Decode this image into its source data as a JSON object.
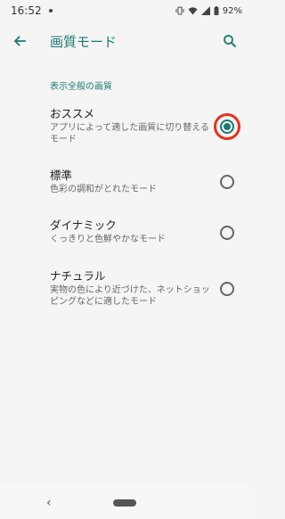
{
  "status": {
    "time": "16:52",
    "battery": "92%"
  },
  "app_bar": {
    "title": "画質モード",
    "back_icon": "arrow-back-icon",
    "search_icon": "search-icon"
  },
  "section": {
    "header": "表示全般の画質"
  },
  "options": [
    {
      "title": "おススメ",
      "desc": "アプリによって適した画質に切り替えるモード",
      "selected": true
    },
    {
      "title": "標準",
      "desc": "色彩の調和がとれたモード",
      "selected": false
    },
    {
      "title": "ダイナミック",
      "desc": "くっきりと色鮮やかなモード",
      "selected": false
    },
    {
      "title": "ナチュラル",
      "desc": "実物の色により近づけた、ネットショッピングなどに適したモード",
      "selected": false
    }
  ],
  "colors": {
    "accent": "#1a7a73",
    "highlight": "#e8301c"
  }
}
